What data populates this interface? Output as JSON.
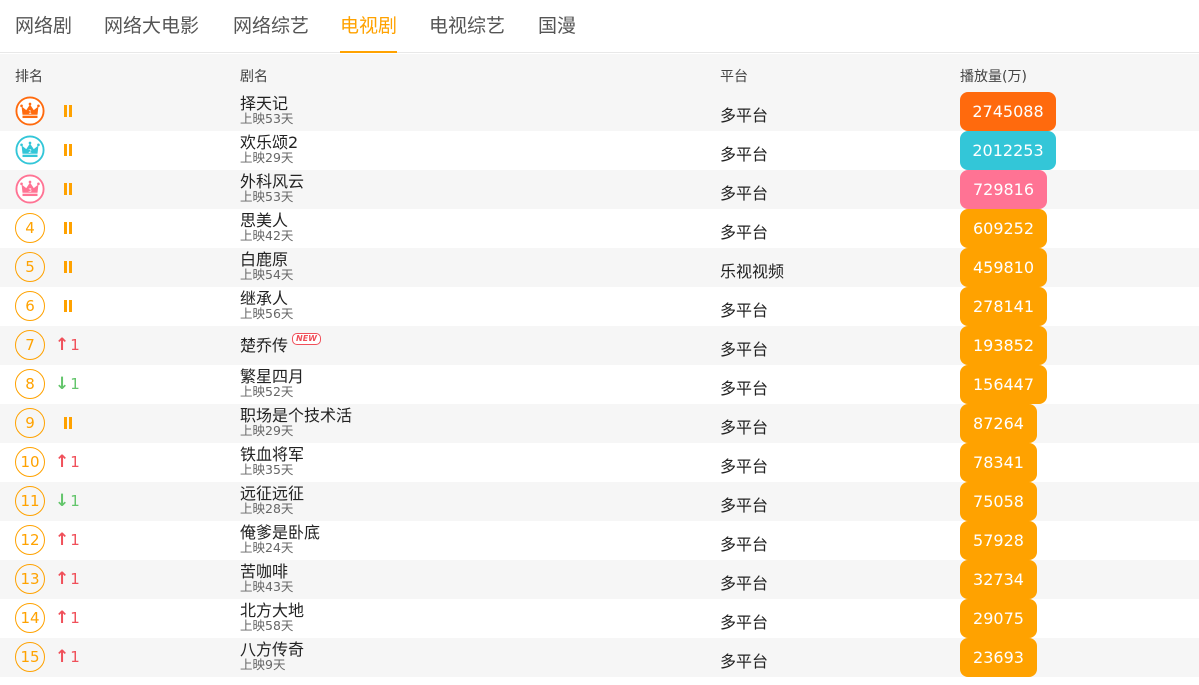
{
  "tabs": [
    {
      "label": "网络剧",
      "active": false
    },
    {
      "label": "网络大电影",
      "active": false
    },
    {
      "label": "网络综艺",
      "active": false
    },
    {
      "label": "电视剧",
      "active": true
    },
    {
      "label": "电视综艺",
      "active": false
    },
    {
      "label": "国漫",
      "active": false
    }
  ],
  "header": {
    "rank": "排名",
    "name": "剧名",
    "platform": "平台",
    "views": "播放量(万)"
  },
  "colors": {
    "accent": "#ffa200",
    "gold": "#ff6a0d",
    "silver": "#33c6d8",
    "bronze": "#ff7394",
    "up": "#f0505a",
    "down": "#63c56b"
  },
  "rows": [
    {
      "rank": "1",
      "medal": "gold",
      "trend": "same",
      "trend_value": "",
      "name": "择天记",
      "sub": "上映53天",
      "new": false,
      "platform": "多平台",
      "views": "2745088"
    },
    {
      "rank": "2",
      "medal": "silver",
      "trend": "same",
      "trend_value": "",
      "name": "欢乐颂2",
      "sub": "上映29天",
      "new": false,
      "platform": "多平台",
      "views": "2012253"
    },
    {
      "rank": "3",
      "medal": "bronze",
      "trend": "same",
      "trend_value": "",
      "name": "外科风云",
      "sub": "上映53天",
      "new": false,
      "platform": "多平台",
      "views": "729816"
    },
    {
      "rank": "4",
      "medal": "",
      "trend": "same",
      "trend_value": "",
      "name": "思美人",
      "sub": "上映42天",
      "new": false,
      "platform": "多平台",
      "views": "609252"
    },
    {
      "rank": "5",
      "medal": "",
      "trend": "same",
      "trend_value": "",
      "name": "白鹿原",
      "sub": "上映54天",
      "new": false,
      "platform": "乐视视频",
      "views": "459810"
    },
    {
      "rank": "6",
      "medal": "",
      "trend": "same",
      "trend_value": "",
      "name": "继承人",
      "sub": "上映56天",
      "new": false,
      "platform": "多平台",
      "views": "278141"
    },
    {
      "rank": "7",
      "medal": "",
      "trend": "up",
      "trend_value": "1",
      "name": "楚乔传",
      "sub": "",
      "new": true,
      "platform": "多平台",
      "views": "193852"
    },
    {
      "rank": "8",
      "medal": "",
      "trend": "down",
      "trend_value": "1",
      "name": "繁星四月",
      "sub": "上映52天",
      "new": false,
      "platform": "多平台",
      "views": "156447"
    },
    {
      "rank": "9",
      "medal": "",
      "trend": "same",
      "trend_value": "",
      "name": "职场是个技术活",
      "sub": "上映29天",
      "new": false,
      "platform": "多平台",
      "views": "87264"
    },
    {
      "rank": "10",
      "medal": "",
      "trend": "up",
      "trend_value": "1",
      "name": "铁血将军",
      "sub": "上映35天",
      "new": false,
      "platform": "多平台",
      "views": "78341"
    },
    {
      "rank": "11",
      "medal": "",
      "trend": "down",
      "trend_value": "1",
      "name": "远征远征",
      "sub": "上映28天",
      "new": false,
      "platform": "多平台",
      "views": "75058"
    },
    {
      "rank": "12",
      "medal": "",
      "trend": "up",
      "trend_value": "1",
      "name": "俺爹是卧底",
      "sub": "上映24天",
      "new": false,
      "platform": "多平台",
      "views": "57928"
    },
    {
      "rank": "13",
      "medal": "",
      "trend": "up",
      "trend_value": "1",
      "name": "苦咖啡",
      "sub": "上映43天",
      "new": false,
      "platform": "多平台",
      "views": "32734"
    },
    {
      "rank": "14",
      "medal": "",
      "trend": "up",
      "trend_value": "1",
      "name": "北方大地",
      "sub": "上映58天",
      "new": false,
      "platform": "多平台",
      "views": "29075"
    },
    {
      "rank": "15",
      "medal": "",
      "trend": "up",
      "trend_value": "1",
      "name": "八方传奇",
      "sub": "上映9天",
      "new": false,
      "platform": "多平台",
      "views": "23693"
    }
  ],
  "new_badge": "NEW"
}
